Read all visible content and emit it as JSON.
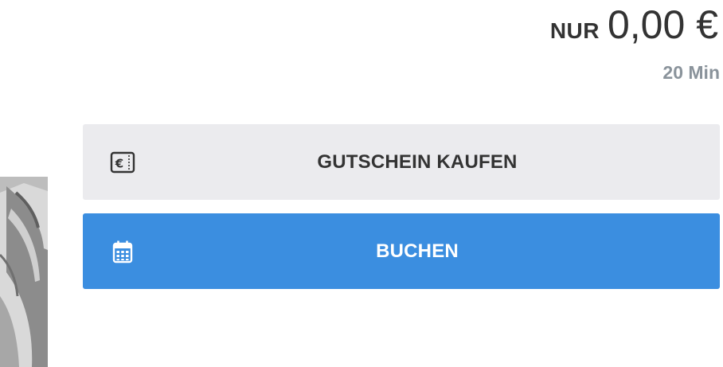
{
  "price": {
    "prefix": "NUR",
    "value": "0,00 €",
    "duration": "20 Min"
  },
  "buttons": {
    "voucher": {
      "label": "GUTSCHEIN KAUFEN",
      "icon": "euro-voucher-icon"
    },
    "book": {
      "label": "BUCHEN",
      "icon": "calendar-icon"
    }
  },
  "colors": {
    "primary": "#3b8ee0",
    "secondary_bg": "#ebebee",
    "text_dark": "#333333",
    "text_muted": "#8a939b"
  }
}
